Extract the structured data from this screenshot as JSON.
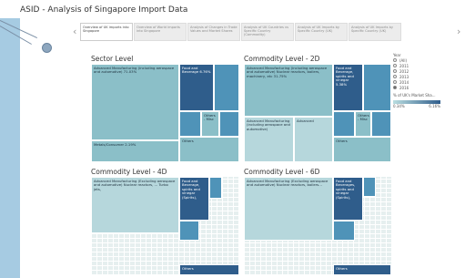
{
  "title": "ASID - Analysis of Singapore Import Data",
  "tabs": [
    {
      "label": "Overview of UK imports into Singapore",
      "active": true
    },
    {
      "label": "Overview of World imports into Singapore",
      "active": false
    },
    {
      "label": "Analysis of Changes in Trade Values and Market Shares",
      "active": false
    },
    {
      "label": "Analysis of UK Countries vs Specific Country (Commodity)",
      "active": false
    },
    {
      "label": "Analysis of UK Imports by Specific Country (UK)",
      "active": false
    },
    {
      "label": "Analysis of UK Imports by Specific Country (UK)",
      "active": false
    },
    {
      "label": "Analysis of UK Imports by Specific Country (UK)",
      "active": false
    }
  ],
  "sections": {
    "sector": "Sector Level",
    "c2d": "Commodity Level - 2D",
    "c4d": "Commodity Level - 4D",
    "c6d": "Commodity Level - 6D"
  },
  "sector": {
    "adv": "Advanced Manufacturing (including aerospace and automotive) 71.03%",
    "food": "Food and Beverage 6.76%",
    "others_bl": "Metals/Consumer 2.19%",
    "others1": "Others - Misc",
    "others2": "Others"
  },
  "c2d": {
    "adv": "Advanced Manufacturing (including aerospace and automotive) Nuclear reactors, boilers, machinery, etc 31.75%",
    "food": "Food and Beverage, spirits and vinegar 5.38%",
    "adv2": "Advanced Manufacturing (including aerospace and automotive)",
    "adv3": "Advanced",
    "others1": "Others - Misc",
    "others2": "Others"
  },
  "c4d": {
    "adv": "Advanced Manufacturing (Excluding aerospace and automotive) Nuclear reactors, ... Turbo jets,",
    "food": "Food and Beverage, spirits and vinegar (Spirits),",
    "others": "Others"
  },
  "c6d": {
    "adv": "Advanced Manufacturing (Excluding aerospace and automotive) Nuclear reactors, boilers...",
    "food": "Food and Beverages, spirits and vinegar (Spirits),",
    "others": "Others"
  },
  "legend": {
    "year_title": "Year",
    "years": [
      "(All)",
      "2011",
      "2012",
      "2013",
      "2014",
      "2016"
    ],
    "selected": "2016",
    "share_title": "% of UK's Market Sha...",
    "min": "0.34%",
    "max": "6.16%"
  }
}
